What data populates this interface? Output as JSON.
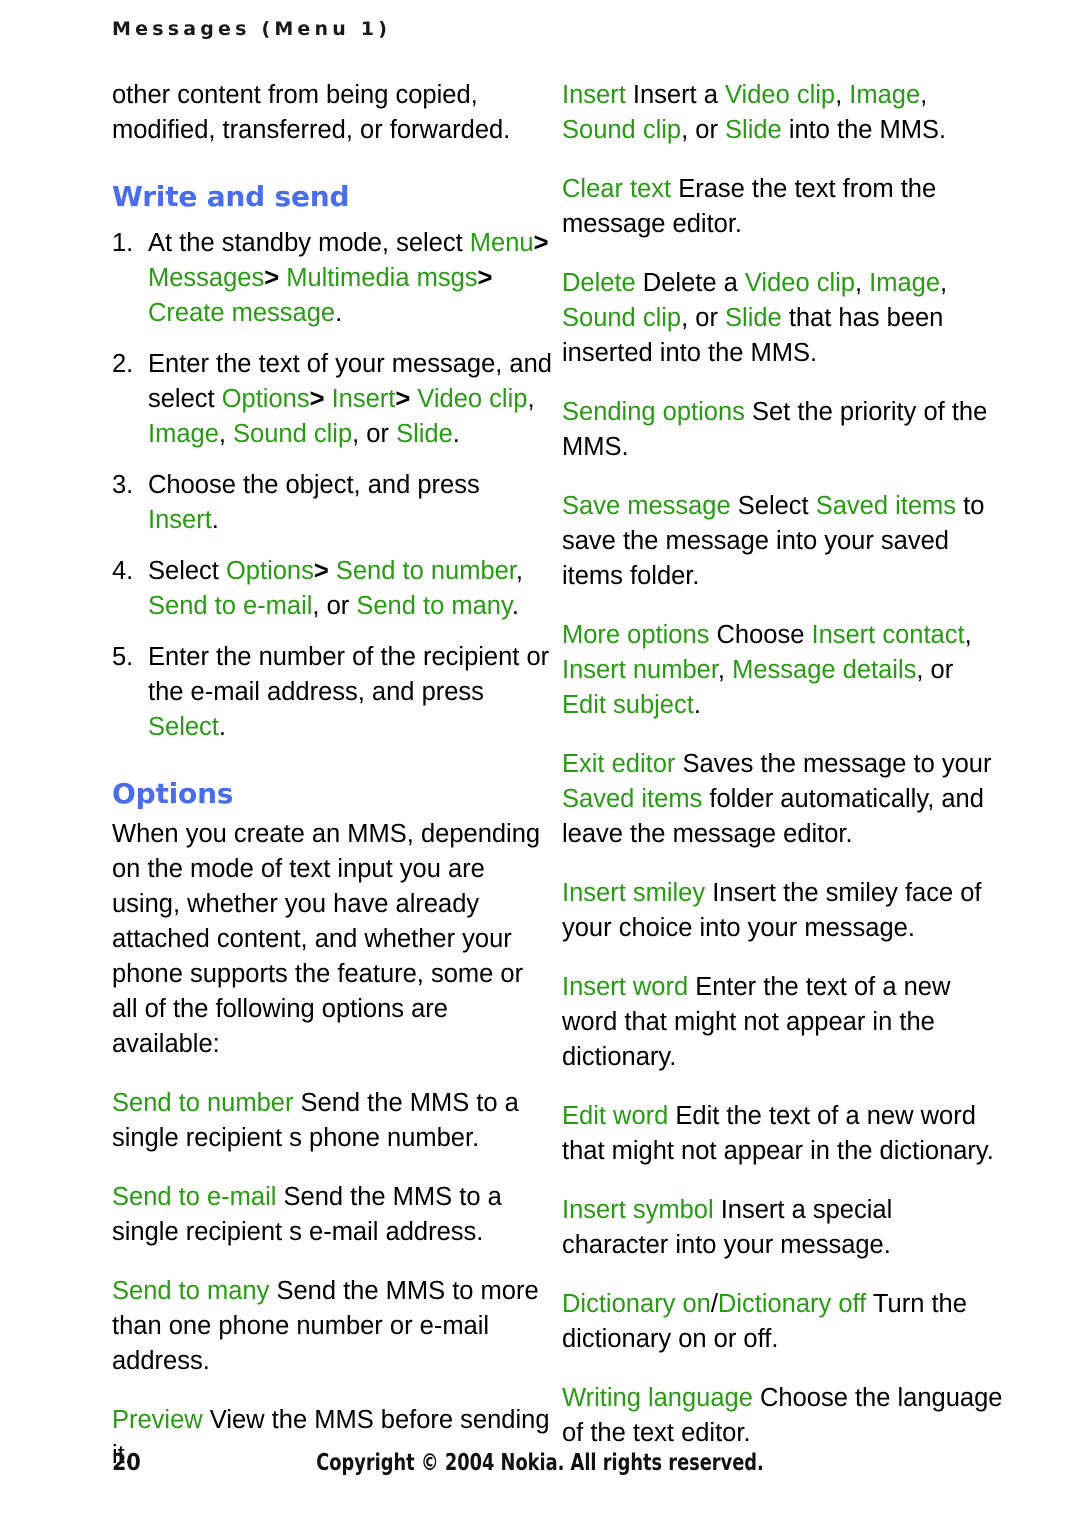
{
  "page": {
    "running_head": "Messages (Menu 1)",
    "page_number": "20",
    "copyright": "Copyright © 2004 Nokia. All rights reserved.",
    "accent_blue": "#4a6ee8",
    "accent_green": "#2a9a16",
    "body_color": "#000000"
  },
  "left_column": {
    "intro_paragraph": "other content from being copied, modified, transferred, or forwarded.",
    "heading_write_and_send": "Write and send",
    "steps": [
      {
        "num": "1.",
        "runs": [
          {
            "text": "At the standby mode, select ",
            "style": "black"
          },
          {
            "text": "Menu",
            "style": "ui"
          },
          {
            "text": "> ",
            "style": "sep"
          },
          {
            "text": "Messages",
            "style": "ui"
          },
          {
            "text": "> ",
            "style": "sep"
          },
          {
            "text": "Multimedia msgs",
            "style": "ui"
          },
          {
            "text": "> ",
            "style": "sep"
          },
          {
            "text": "Create message",
            "style": "ui"
          },
          {
            "text": ".",
            "style": "black"
          }
        ]
      },
      {
        "num": "2.",
        "runs": [
          {
            "text": "Enter the text of your message, and select ",
            "style": "black"
          },
          {
            "text": "Options",
            "style": "ui"
          },
          {
            "text": "> ",
            "style": "sep"
          },
          {
            "text": "Insert",
            "style": "ui"
          },
          {
            "text": "> ",
            "style": "sep"
          },
          {
            "text": "Video clip",
            "style": "ui"
          },
          {
            "text": ", ",
            "style": "black"
          },
          {
            "text": "Image",
            "style": "ui"
          },
          {
            "text": ", ",
            "style": "black"
          },
          {
            "text": "Sound clip",
            "style": "ui"
          },
          {
            "text": ", or ",
            "style": "black"
          },
          {
            "text": "Slide",
            "style": "ui"
          },
          {
            "text": ".",
            "style": "black"
          }
        ]
      },
      {
        "num": "3.",
        "runs": [
          {
            "text": "Choose the object, and press ",
            "style": "black"
          },
          {
            "text": "Insert",
            "style": "ui"
          },
          {
            "text": ".",
            "style": "black"
          }
        ]
      },
      {
        "num": "4.",
        "runs": [
          {
            "text": "Select ",
            "style": "black"
          },
          {
            "text": "Options",
            "style": "ui"
          },
          {
            "text": "> ",
            "style": "sep"
          },
          {
            "text": "Send to number",
            "style": "ui"
          },
          {
            "text": ", ",
            "style": "black"
          },
          {
            "text": "Send to e-mail",
            "style": "ui"
          },
          {
            "text": ", or ",
            "style": "black"
          },
          {
            "text": "Send to many",
            "style": "ui"
          },
          {
            "text": ".",
            "style": "black"
          }
        ]
      },
      {
        "num": "5.",
        "runs": [
          {
            "text": "Enter the number of the recipient or the e-mail address, and press ",
            "style": "black"
          },
          {
            "text": "Select",
            "style": "ui"
          },
          {
            "text": ".",
            "style": "black"
          }
        ]
      }
    ],
    "heading_options": "Options",
    "options_intro": "When you create an MMS, depending on the mode of text input you are using, whether you have already attached content, and whether your phone supports the feature, some or all of the following options are available:",
    "options": [
      {
        "runs": [
          {
            "text": "Send to number",
            "style": "ui"
          },
          {
            "text": " Send the MMS to a single recipient s phone number.",
            "style": "black"
          }
        ]
      },
      {
        "runs": [
          {
            "text": "Send to e-mail",
            "style": "ui"
          },
          {
            "text": " Send the MMS to a single recipient s e-mail address.",
            "style": "black"
          }
        ]
      },
      {
        "runs": [
          {
            "text": "Send to many",
            "style": "ui"
          },
          {
            "text": " Send the MMS to more than one phone number or e-mail address.",
            "style": "black"
          }
        ]
      },
      {
        "runs": [
          {
            "text": "Preview",
            "style": "ui"
          },
          {
            "text": " View the MMS before sending it.",
            "style": "black"
          }
        ]
      }
    ]
  },
  "right_column": {
    "options": [
      {
        "runs": [
          {
            "text": "Insert",
            "style": "ui"
          },
          {
            "text": " Insert a ",
            "style": "black"
          },
          {
            "text": "Video clip",
            "style": "ui"
          },
          {
            "text": ", ",
            "style": "black"
          },
          {
            "text": "Image",
            "style": "ui"
          },
          {
            "text": ", ",
            "style": "black"
          },
          {
            "text": "Sound clip",
            "style": "ui"
          },
          {
            "text": ", or ",
            "style": "black"
          },
          {
            "text": "Slide",
            "style": "ui"
          },
          {
            "text": " into the MMS.",
            "style": "black"
          }
        ]
      },
      {
        "runs": [
          {
            "text": "Clear text",
            "style": "ui"
          },
          {
            "text": " Erase the text from the message editor.",
            "style": "black"
          }
        ]
      },
      {
        "runs": [
          {
            "text": "Delete",
            "style": "ui"
          },
          {
            "text": " Delete a ",
            "style": "black"
          },
          {
            "text": "Video clip",
            "style": "ui"
          },
          {
            "text": ", ",
            "style": "black"
          },
          {
            "text": "Image",
            "style": "ui"
          },
          {
            "text": ", ",
            "style": "black"
          },
          {
            "text": "Sound clip",
            "style": "ui"
          },
          {
            "text": ", or ",
            "style": "black"
          },
          {
            "text": "Slide",
            "style": "ui"
          },
          {
            "text": " that has been inserted into the MMS.",
            "style": "black"
          }
        ]
      },
      {
        "runs": [
          {
            "text": "Sending options",
            "style": "ui"
          },
          {
            "text": " Set the priority of the MMS.",
            "style": "black"
          }
        ]
      },
      {
        "runs": [
          {
            "text": "Save message",
            "style": "ui"
          },
          {
            "text": " Select ",
            "style": "black"
          },
          {
            "text": "Saved items",
            "style": "ui"
          },
          {
            "text": " to save the message into your saved items folder.",
            "style": "black"
          }
        ]
      },
      {
        "runs": [
          {
            "text": "More options",
            "style": "ui"
          },
          {
            "text": " Choose ",
            "style": "black"
          },
          {
            "text": "Insert contact",
            "style": "ui"
          },
          {
            "text": ", ",
            "style": "black"
          },
          {
            "text": "Insert number",
            "style": "ui"
          },
          {
            "text": ", ",
            "style": "black"
          },
          {
            "text": "Message details",
            "style": "ui"
          },
          {
            "text": ", or ",
            "style": "black"
          },
          {
            "text": "Edit subject",
            "style": "ui"
          },
          {
            "text": ".",
            "style": "black"
          }
        ]
      },
      {
        "runs": [
          {
            "text": "Exit editor",
            "style": "ui"
          },
          {
            "text": " Saves the message to your ",
            "style": "black"
          },
          {
            "text": "Saved items",
            "style": "ui"
          },
          {
            "text": " folder automatically, and leave the message editor.",
            "style": "black"
          }
        ]
      },
      {
        "runs": [
          {
            "text": "Insert smiley",
            "style": "ui"
          },
          {
            "text": " Insert the smiley face of your choice into your message.",
            "style": "black"
          }
        ]
      },
      {
        "runs": [
          {
            "text": "Insert word",
            "style": "ui"
          },
          {
            "text": " Enter the text of a new word that might not appear in the dictionary.",
            "style": "black"
          }
        ]
      },
      {
        "runs": [
          {
            "text": "Edit word",
            "style": "ui"
          },
          {
            "text": " Edit the text of a new word that might not appear in the dictionary.",
            "style": "black"
          }
        ]
      },
      {
        "runs": [
          {
            "text": "Insert symbol",
            "style": "ui"
          },
          {
            "text": " Insert a special character into your message.",
            "style": "black"
          }
        ]
      },
      {
        "runs": [
          {
            "text": "Dictionary on",
            "style": "ui"
          },
          {
            "text": "/",
            "style": "black"
          },
          {
            "text": "Dictionary off",
            "style": "ui"
          },
          {
            "text": " Turn the dictionary on or off.",
            "style": "black"
          }
        ]
      },
      {
        "runs": [
          {
            "text": "Writing language",
            "style": "ui"
          },
          {
            "text": " Choose the language of the text editor.",
            "style": "black"
          }
        ]
      }
    ]
  }
}
